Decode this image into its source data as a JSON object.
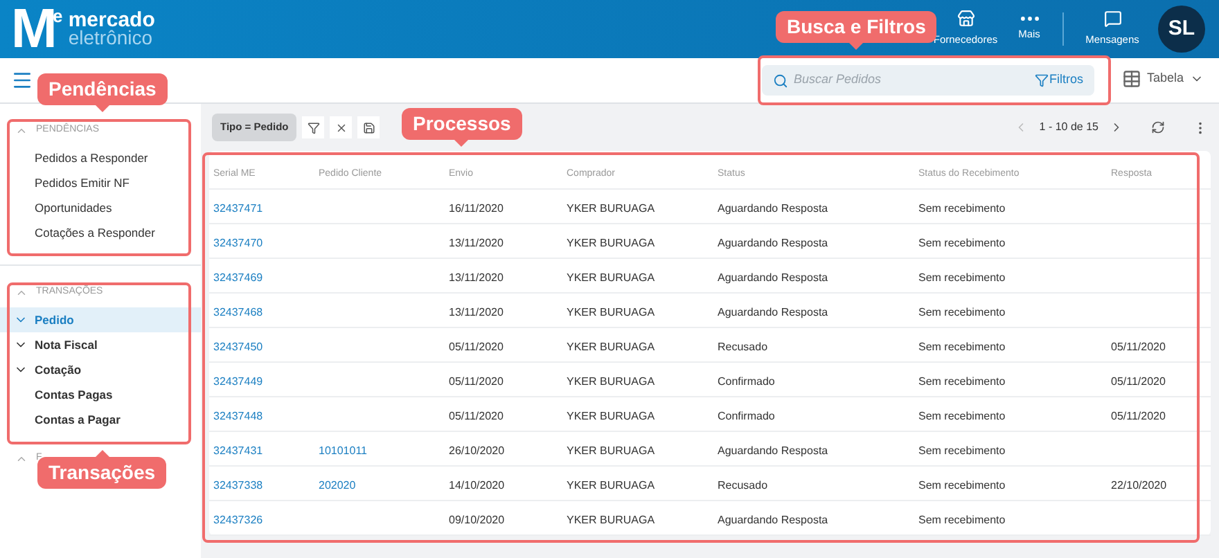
{
  "header": {
    "logo_letter": "M",
    "logo_sup": "e",
    "brand_top": "mercado",
    "brand_bottom": "eletrônico",
    "nav": [
      {
        "label": "Fornecedores",
        "kind": "store"
      },
      {
        "label": "Mais",
        "kind": "more"
      },
      {
        "label": "Mensagens",
        "kind": "chat"
      }
    ],
    "avatar": "SL"
  },
  "toolbar": {
    "search": {
      "placeholder": "Buscar Pedidos"
    },
    "filters": "Filtros",
    "view": "Tabela"
  },
  "sidebar": {
    "sections": [
      {
        "title": "PENDÊNCIAS",
        "items": [
          {
            "label": "Pedidos a Responder",
            "selected": false
          },
          {
            "label": "Pedidos Emitir NF",
            "selected": false
          },
          {
            "label": "Oportunidades",
            "selected": false
          },
          {
            "label": "Cotações a Responder",
            "selected": false
          }
        ]
      },
      {
        "title": "TRANSAÇÕES",
        "items": [
          {
            "label": "Pedido",
            "selected": true,
            "expandable": true
          },
          {
            "label": "Nota Fiscal",
            "selected": false,
            "expandable": true
          },
          {
            "label": "Cotação",
            "selected": false,
            "expandable": true
          },
          {
            "label": "Contas Pagas",
            "selected": false,
            "expandable": false
          },
          {
            "label": "Contas a Pagar",
            "selected": false,
            "expandable": false
          }
        ]
      },
      {
        "title": "F"
      }
    ]
  },
  "filter_chip": "Tipo = Pedido",
  "pagination": "1 - 10 de 15",
  "table": {
    "columns": [
      "Serial ME",
      "Pedido Cliente",
      "Envio",
      "Comprador",
      "Status",
      "Status do Recebimento",
      "Resposta"
    ],
    "rows": [
      [
        "32437471",
        "",
        "16/11/2020",
        "YKER BURUAGA",
        "Aguardando Resposta",
        "Sem recebimento",
        ""
      ],
      [
        "32437470",
        "",
        "13/11/2020",
        "YKER BURUAGA",
        "Aguardando Resposta",
        "Sem recebimento",
        ""
      ],
      [
        "32437469",
        "",
        "13/11/2020",
        "YKER BURUAGA",
        "Aguardando Resposta",
        "Sem recebimento",
        ""
      ],
      [
        "32437468",
        "",
        "13/11/2020",
        "YKER BURUAGA",
        "Aguardando Resposta",
        "Sem recebimento",
        ""
      ],
      [
        "32437450",
        "",
        "05/11/2020",
        "YKER BURUAGA",
        "Recusado",
        "Sem recebimento",
        "05/11/2020"
      ],
      [
        "32437449",
        "",
        "05/11/2020",
        "YKER BURUAGA",
        "Confirmado",
        "Sem recebimento",
        "05/11/2020"
      ],
      [
        "32437448",
        "",
        "05/11/2020",
        "YKER BURUAGA",
        "Confirmado",
        "Sem recebimento",
        "05/11/2020"
      ],
      [
        "32437431",
        "10101011",
        "26/10/2020",
        "YKER BURUAGA",
        "Aguardando Resposta",
        "Sem recebimento",
        ""
      ],
      [
        "32437338",
        "202020",
        "14/10/2020",
        "YKER BURUAGA",
        "Recusado",
        "Sem recebimento",
        "22/10/2020"
      ],
      [
        "32437326",
        "",
        "09/10/2020",
        "YKER BURUAGA",
        "Aguardando Resposta",
        "Sem recebimento",
        ""
      ]
    ]
  },
  "callouts": [
    "Pendências",
    "Busca e Filtros",
    "Processos",
    "Transações"
  ]
}
